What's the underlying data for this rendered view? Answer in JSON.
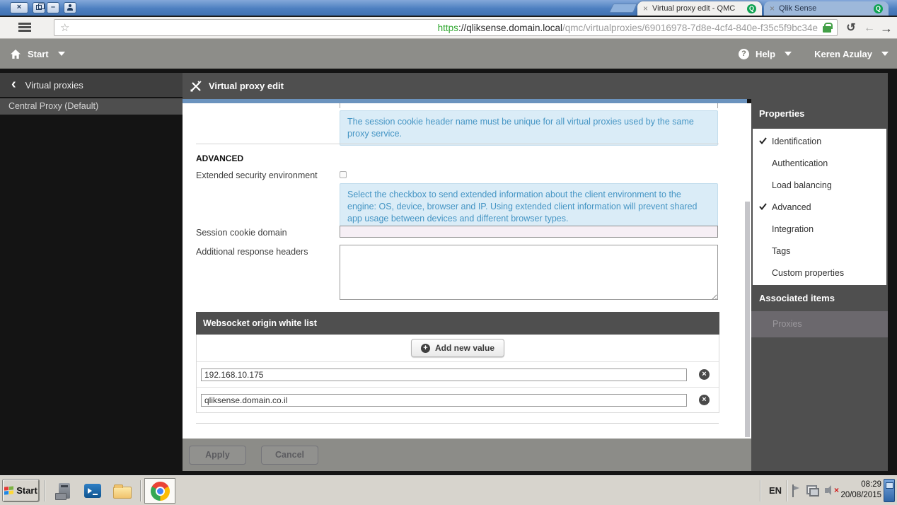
{
  "browser": {
    "tabs": [
      {
        "label": "Virtual proxy edit - QMC",
        "active": true
      },
      {
        "label": "Qlik Sense",
        "active": false
      }
    ],
    "url": {
      "scheme": "https",
      "host": "://qliksense.domain.local",
      "path": "/qmc/virtualproxies/69016978-7d8e-4cf4-840e-f35c5f9bc34e"
    }
  },
  "qmc_nav": {
    "start_label": "Start",
    "help_label": "Help",
    "user_name": "Keren Azulay"
  },
  "left_sidebar": {
    "back_label": "Virtual proxies",
    "selected_item": "Central Proxy (Default)"
  },
  "main": {
    "title": "Virtual proxy edit",
    "session_cookie_info": "The session cookie header name must be unique for all virtual proxies used by the same proxy service.",
    "advanced_heading": "ADVANCED",
    "extended_security": {
      "label": "Extended security environment",
      "checked": false,
      "info": "Select the checkbox to send extended information about the client environment to the engine: OS, device, browser and IP. Using extended client information will prevent shared app usage between devices and different browser types."
    },
    "session_cookie_domain": {
      "label": "Session cookie domain",
      "value": ""
    },
    "additional_response_headers": {
      "label": "Additional response headers",
      "value": ""
    },
    "websocket": {
      "title": "Websocket origin white list",
      "add_button": "Add new value",
      "values": [
        "192.168.10.175",
        "qliksense.domain.co.il"
      ]
    },
    "actions": {
      "apply": "Apply",
      "cancel": "Cancel"
    }
  },
  "right_sidebar": {
    "properties_title": "Properties",
    "properties_items": [
      {
        "label": "Identification",
        "checked": true
      },
      {
        "label": "Authentication",
        "checked": false
      },
      {
        "label": "Load balancing",
        "checked": false
      },
      {
        "label": "Advanced",
        "checked": true
      },
      {
        "label": "Integration",
        "checked": false
      },
      {
        "label": "Tags",
        "checked": false
      },
      {
        "label": "Custom properties",
        "checked": false
      }
    ],
    "associated_title": "Associated items",
    "associated_items": [
      {
        "label": "Proxies"
      }
    ]
  },
  "taskbar": {
    "start_label": "Start",
    "language": "EN",
    "time": "08:29",
    "date": "20/08/2015"
  },
  "icons": {
    "close": "×",
    "minimize": "–",
    "bookmark_star": "☆",
    "reload": "↺",
    "back": "←",
    "forward": "→",
    "chevron_left": "‹",
    "help": "?",
    "plus": "+",
    "delete": "×",
    "qlik_q": "Q"
  },
  "colors": {
    "titlebar_blue": "#4d7fc0",
    "qmc_bar_gray": "#8d8d89",
    "panel_header_gray": "#4f4f4f",
    "accent_blue_bar": "#6b93be",
    "info_bg": "#daecf7",
    "info_text": "#4595c4",
    "https_green": "#2fa72f",
    "favicon_green": "#0fa352",
    "padlock_green": "#43a047",
    "disabled_field_pink": "#f6eff5"
  }
}
